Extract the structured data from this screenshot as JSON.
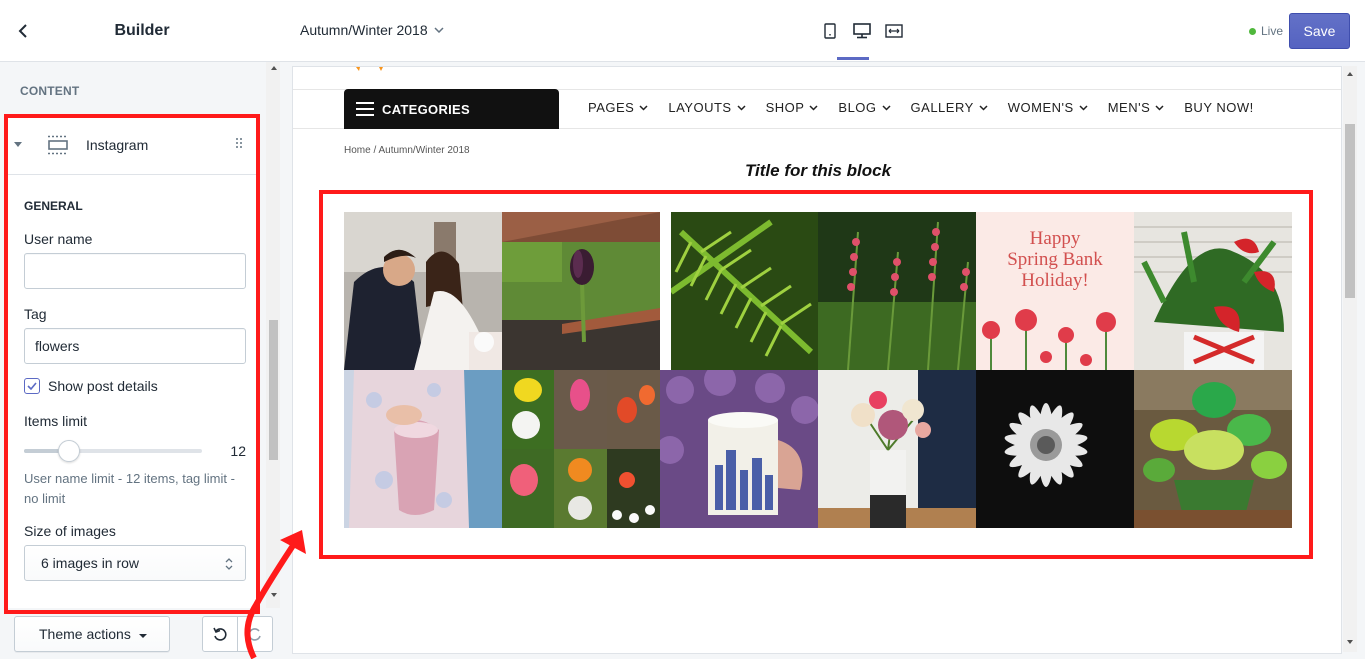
{
  "sidebar": {
    "title": "Builder",
    "section_title": "CONTENT",
    "block": {
      "name": "Instagram",
      "general_title": "GENERAL",
      "user_name_label": "User name",
      "user_name_value": "",
      "tag_label": "Tag",
      "tag_value": "flowers",
      "show_post_details_label": "Show post details",
      "show_post_details_checked": true,
      "items_limit_label": "Items limit",
      "items_limit_value": "12",
      "items_limit_fraction": 0.25,
      "help_text": "User name limit - 12 items, tag limit - no limit",
      "size_label": "Size of images",
      "size_value": "6 images in row"
    },
    "footer": {
      "theme_actions_label": "Theme actions"
    }
  },
  "topbar": {
    "template_name": "Autumn/Winter 2018",
    "live_label": "Live",
    "save_label": "Save",
    "active_device": "desktop"
  },
  "preview": {
    "categories_label": "CATEGORIES",
    "nav": [
      {
        "label": "PAGES",
        "dropdown": true
      },
      {
        "label": "LAYOUTS",
        "dropdown": true
      },
      {
        "label": "SHOP",
        "dropdown": true
      },
      {
        "label": "BLOG",
        "dropdown": true
      },
      {
        "label": "GALLERY",
        "dropdown": true
      },
      {
        "label": "WOMEN'S",
        "dropdown": true
      },
      {
        "label": "MEN'S",
        "dropdown": true
      },
      {
        "label": "BUY NOW!",
        "dropdown": false
      }
    ],
    "breadcrumb": "Home  /  Autumn/Winter 2018",
    "block_title": "Title for this block",
    "tiles": [
      {
        "name": "wedding-couple-photo"
      },
      {
        "name": "purple-tulip-photo"
      },
      {
        "name": "green-fern-photo"
      },
      {
        "name": "pink-flower-spikes-photo"
      },
      {
        "name": "spring-bank-holiday-card",
        "text": "Happy Spring Bank Holiday!"
      },
      {
        "name": "red-anthurium-photo"
      },
      {
        "name": "pastel-dress-photo"
      },
      {
        "name": "tulip-collage-photo"
      },
      {
        "name": "mug-lilac-photo"
      },
      {
        "name": "rose-vase-photo"
      },
      {
        "name": "white-daisy-bw-photo"
      },
      {
        "name": "green-bouquet-photo"
      }
    ]
  },
  "colors": {
    "accent": "#5c6ac4",
    "highlight": "#ff1a1a",
    "live": "#50b83c"
  }
}
